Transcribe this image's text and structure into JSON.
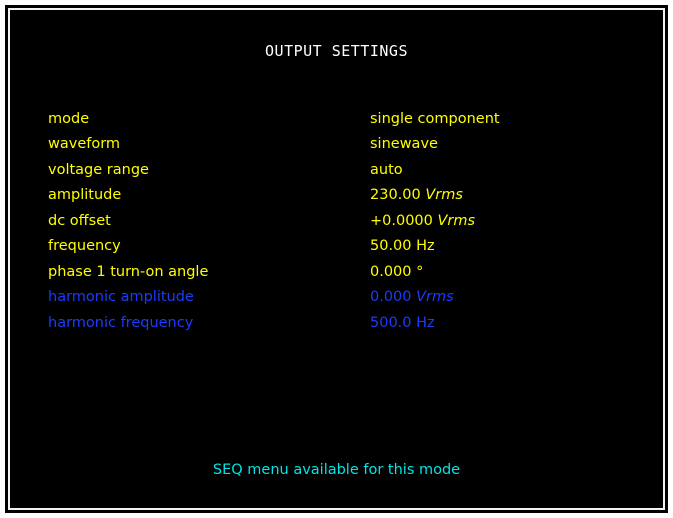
{
  "screen": {
    "title": "OUTPUT SETTINGS",
    "colors": {
      "background": "#000000",
      "title": "#ffffff",
      "active_text": "#ffff00",
      "inactive_text": "#1a3cff",
      "footer_text": "#00e5e5"
    },
    "settings": [
      {
        "label": "mode",
        "value": "single component",
        "unit": "",
        "state": "active"
      },
      {
        "label": "waveform",
        "value": "sinewave",
        "unit": "",
        "state": "active"
      },
      {
        "label": "voltage range",
        "value": "auto",
        "unit": "",
        "state": "active"
      },
      {
        "label": "amplitude",
        "value": "230.00",
        "unit": "Vrms",
        "state": "active"
      },
      {
        "label": "dc offset",
        "value": "+0.0000",
        "unit": "Vrms",
        "state": "active"
      },
      {
        "label": "frequency",
        "value": "50.00",
        "unit": "Hz",
        "state": "active"
      },
      {
        "label": "phase 1 turn-on angle",
        "value": "0.000",
        "unit": "°",
        "state": "active"
      },
      {
        "label": "harmonic amplitude",
        "value": "0.000",
        "unit": "Vrms",
        "state": "inactive"
      },
      {
        "label": "harmonic frequency",
        "value": "500.0",
        "unit": "Hz",
        "state": "inactive"
      }
    ],
    "footer": "SEQ menu available for this mode"
  }
}
